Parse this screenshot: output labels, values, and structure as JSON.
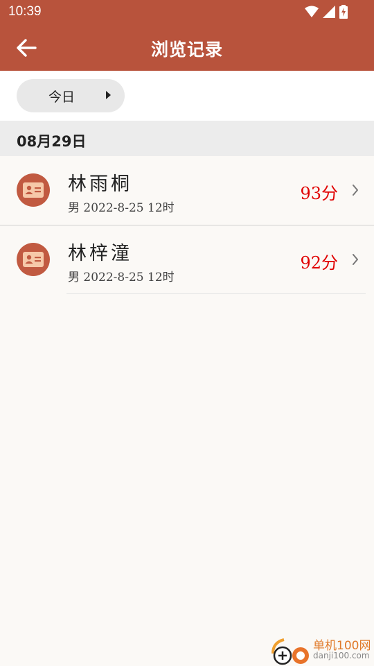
{
  "status_bar": {
    "time": "10:39"
  },
  "app_bar": {
    "title": "浏览记录",
    "back_icon": "arrow-back-icon"
  },
  "filter": {
    "selected_day": "今日"
  },
  "sections": [
    {
      "date": "08月29日",
      "records": [
        {
          "name": "林雨桐",
          "gender": "男",
          "birth": "2022-8-25 12时",
          "score": "93分"
        },
        {
          "name": "林梓潼",
          "gender": "男",
          "birth": "2022-8-25 12时",
          "score": "92分"
        }
      ]
    }
  ],
  "watermark": {
    "line1": "单机100网",
    "line2": "danji100.com"
  },
  "colors": {
    "primary": "#b8533c",
    "score": "#e00000",
    "avatar": "#c15a41"
  }
}
